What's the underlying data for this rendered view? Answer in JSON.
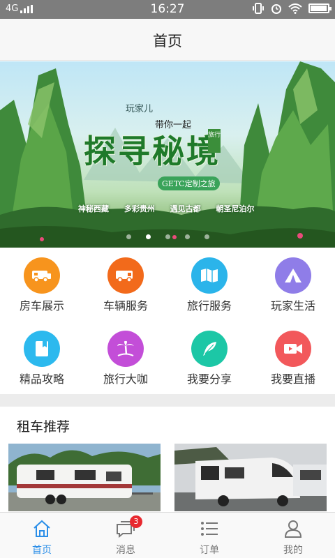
{
  "status_bar": {
    "network": "4G",
    "time": "16:27",
    "battery_level": 0.95
  },
  "header": {
    "title": "首页"
  },
  "banner": {
    "brand": "玩家儿",
    "with_you": "带你一起",
    "main_title": "探寻秘境",
    "seal": "旅行",
    "tag": "GETC定制之旅",
    "places": [
      "神秘西藏",
      "多彩贵州",
      "遇见古都",
      "朝圣尼泊尔"
    ],
    "slide_count": 5,
    "active_slide": 1
  },
  "grid": {
    "items": [
      {
        "label": "房车展示",
        "icon": "rv-icon",
        "color": "#f7941d"
      },
      {
        "label": "车辆服务",
        "icon": "vehicle-service-icon",
        "color": "#f26a1b"
      },
      {
        "label": "旅行服务",
        "icon": "map-icon",
        "color": "#2bb4ea"
      },
      {
        "label": "玩家生活",
        "icon": "tent-icon",
        "color": "#8f7de8"
      },
      {
        "label": "精品攻略",
        "icon": "guide-book-icon",
        "color": "#2cb9ee"
      },
      {
        "label": "旅行大咖",
        "icon": "palm-tree-icon",
        "color": "#c34ed8"
      },
      {
        "label": "我要分享",
        "icon": "feather-icon",
        "color": "#1cc7a6"
      },
      {
        "label": "我要直播",
        "icon": "video-camera-icon",
        "color": "#f2585b"
      }
    ]
  },
  "rent": {
    "title": "租车推荐"
  },
  "tabbar": {
    "tabs": [
      {
        "label": "首页",
        "icon": "home-icon",
        "active": true
      },
      {
        "label": "消息",
        "icon": "message-icon",
        "badge": "3"
      },
      {
        "label": "订单",
        "icon": "order-list-icon"
      },
      {
        "label": "我的",
        "icon": "user-icon"
      }
    ]
  },
  "colors": {
    "accent": "#2a8ee8",
    "badge": "#e8292f"
  }
}
